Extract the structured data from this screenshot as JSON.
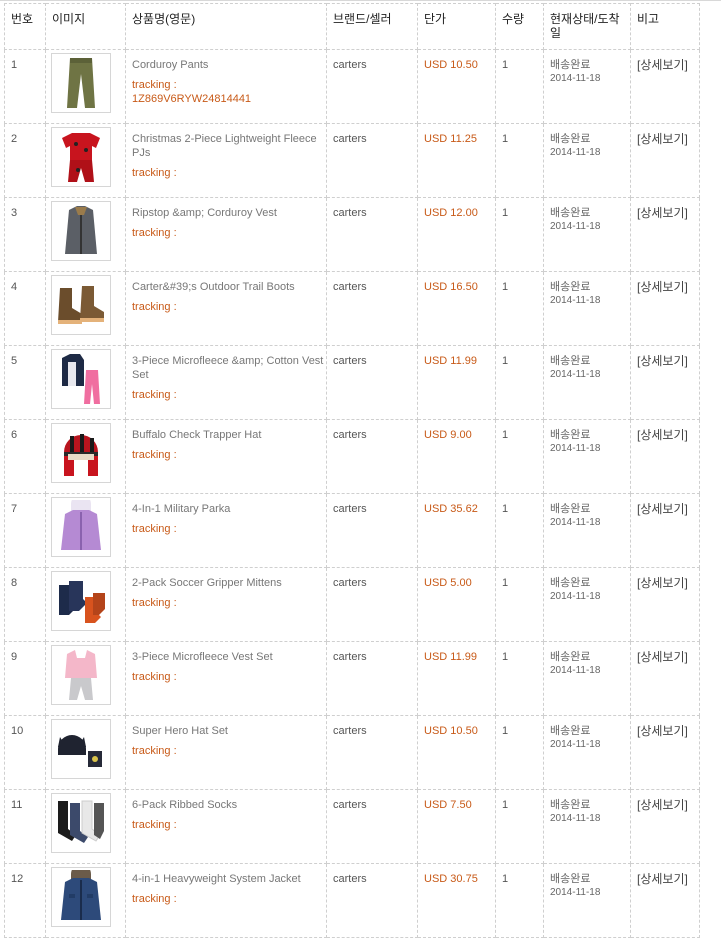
{
  "headers": {
    "no": "번호",
    "image": "이미지",
    "name": "상품명(영문)",
    "brand": "브랜드/셀러",
    "price": "단가",
    "qty": "수량",
    "status": "현재상태/도착일",
    "note": "비고"
  },
  "rows": [
    {
      "no": "1",
      "name": "Corduroy Pants",
      "tracking_label": "tracking :",
      "tracking_no": "1Z869V6RYW24814441",
      "brand": "carters",
      "price": "USD 10.50",
      "qty": "1",
      "status": "배송완료",
      "date": "2014-11-18",
      "detail": "[상세보기]",
      "icon": "pants-icon"
    },
    {
      "no": "2",
      "name": "Christmas 2-Piece Lightweight Fleece PJs",
      "tracking_label": "tracking :",
      "tracking_no": "",
      "brand": "carters",
      "price": "USD 11.25",
      "qty": "1",
      "status": "배송완료",
      "date": "2014-11-18",
      "detail": "[상세보기]",
      "icon": "pajamas-icon"
    },
    {
      "no": "3",
      "name": "Ripstop &amp; Corduroy Vest",
      "tracking_label": "tracking :",
      "tracking_no": "",
      "brand": "carters",
      "price": "USD 12.00",
      "qty": "1",
      "status": "배송완료",
      "date": "2014-11-18",
      "detail": "[상세보기]",
      "icon": "vest-icon"
    },
    {
      "no": "4",
      "name": "Carter&#39;s Outdoor Trail Boots",
      "tracking_label": "tracking :",
      "tracking_no": "",
      "brand": "carters",
      "price": "USD 16.50",
      "qty": "1",
      "status": "배송완료",
      "date": "2014-11-18",
      "detail": "[상세보기]",
      "icon": "boots-icon"
    },
    {
      "no": "5",
      "name": "3-Piece Microfleece &amp; Cotton Vest Set",
      "tracking_label": "tracking :",
      "tracking_no": "",
      "brand": "carters",
      "price": "USD 11.99",
      "qty": "1",
      "status": "배송완료",
      "date": "2014-11-18",
      "detail": "[상세보기]",
      "icon": "vest-set-icon"
    },
    {
      "no": "6",
      "name": "Buffalo Check Trapper Hat",
      "tracking_label": "tracking :",
      "tracking_no": "",
      "brand": "carters",
      "price": "USD 9.00",
      "qty": "1",
      "status": "배송완료",
      "date": "2014-11-18",
      "detail": "[상세보기]",
      "icon": "hat-icon"
    },
    {
      "no": "7",
      "name": "4-In-1 Military Parka",
      "tracking_label": "tracking :",
      "tracking_no": "",
      "brand": "carters",
      "price": "USD 35.62",
      "qty": "1",
      "status": "배송완료",
      "date": "2014-11-18",
      "detail": "[상세보기]",
      "icon": "parka-icon"
    },
    {
      "no": "8",
      "name": "2-Pack Soccer Gripper Mittens",
      "tracking_label": "tracking :",
      "tracking_no": "",
      "brand": "carters",
      "price": "USD 5.00",
      "qty": "1",
      "status": "배송완료",
      "date": "2014-11-18",
      "detail": "[상세보기]",
      "icon": "mittens-icon"
    },
    {
      "no": "9",
      "name": "3-Piece Microfleece Vest Set",
      "tracking_label": "tracking :",
      "tracking_no": "",
      "brand": "carters",
      "price": "USD 11.99",
      "qty": "1",
      "status": "배송완료",
      "date": "2014-11-18",
      "detail": "[상세보기]",
      "icon": "fleece-vest-icon"
    },
    {
      "no": "10",
      "name": "Super Hero Hat Set",
      "tracking_label": "tracking :",
      "tracking_no": "",
      "brand": "carters",
      "price": "USD 10.50",
      "qty": "1",
      "status": "배송완료",
      "date": "2014-11-18",
      "detail": "[상세보기]",
      "icon": "hero-hat-icon"
    },
    {
      "no": "11",
      "name": "6-Pack Ribbed Socks",
      "tracking_label": "tracking :",
      "tracking_no": "",
      "brand": "carters",
      "price": "USD 7.50",
      "qty": "1",
      "status": "배송완료",
      "date": "2014-11-18",
      "detail": "[상세보기]",
      "icon": "socks-icon"
    },
    {
      "no": "12",
      "name": "4-in-1 Heavyweight System Jacket",
      "tracking_label": "tracking :",
      "tracking_no": "",
      "brand": "carters",
      "price": "USD 30.75",
      "qty": "1",
      "status": "배송완료",
      "date": "2014-11-18",
      "detail": "[상세보기]",
      "icon": "jacket-icon"
    }
  ],
  "colors": {
    "accent": "#c85a18",
    "border": "#cfcfcf",
    "text": "#555555"
  }
}
